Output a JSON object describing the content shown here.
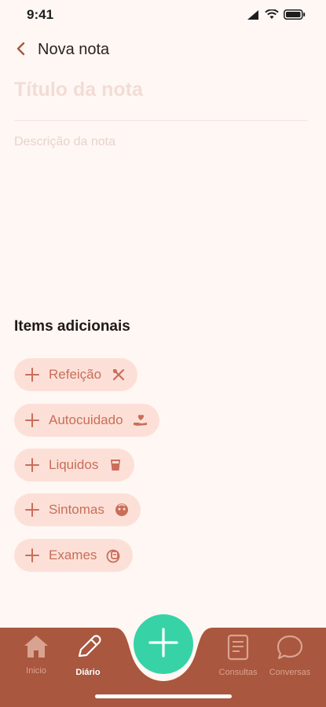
{
  "status_bar": {
    "time": "9:41"
  },
  "header": {
    "title": "Nova nota"
  },
  "note": {
    "title_placeholder": "Título da nota",
    "description_placeholder": "Descrição da nota"
  },
  "additional": {
    "title": "Items adicionais",
    "items": [
      {
        "label": "Refeição",
        "icon": "utensils-icon"
      },
      {
        "label": "Autocuidado",
        "icon": "hand-heart-icon"
      },
      {
        "label": "Liquidos",
        "icon": "cup-icon"
      },
      {
        "label": "Sintomas",
        "icon": "face-icon"
      },
      {
        "label": "Exames",
        "icon": "test-tube-icon"
      }
    ]
  },
  "tabs": [
    {
      "label": "Inicio",
      "icon": "home-icon",
      "active": false
    },
    {
      "label": "Diário",
      "icon": "pencil-icon",
      "active": true
    },
    {
      "label": "Consultas",
      "icon": "document-icon",
      "active": false
    },
    {
      "label": "Conversas",
      "icon": "chat-icon",
      "active": false
    }
  ],
  "colors": {
    "background": "#FFF7F3",
    "accent": "#A9573E",
    "chip_bg": "#FCE0D7",
    "chip_text": "#C96E5A",
    "fab": "#37D3A6"
  }
}
